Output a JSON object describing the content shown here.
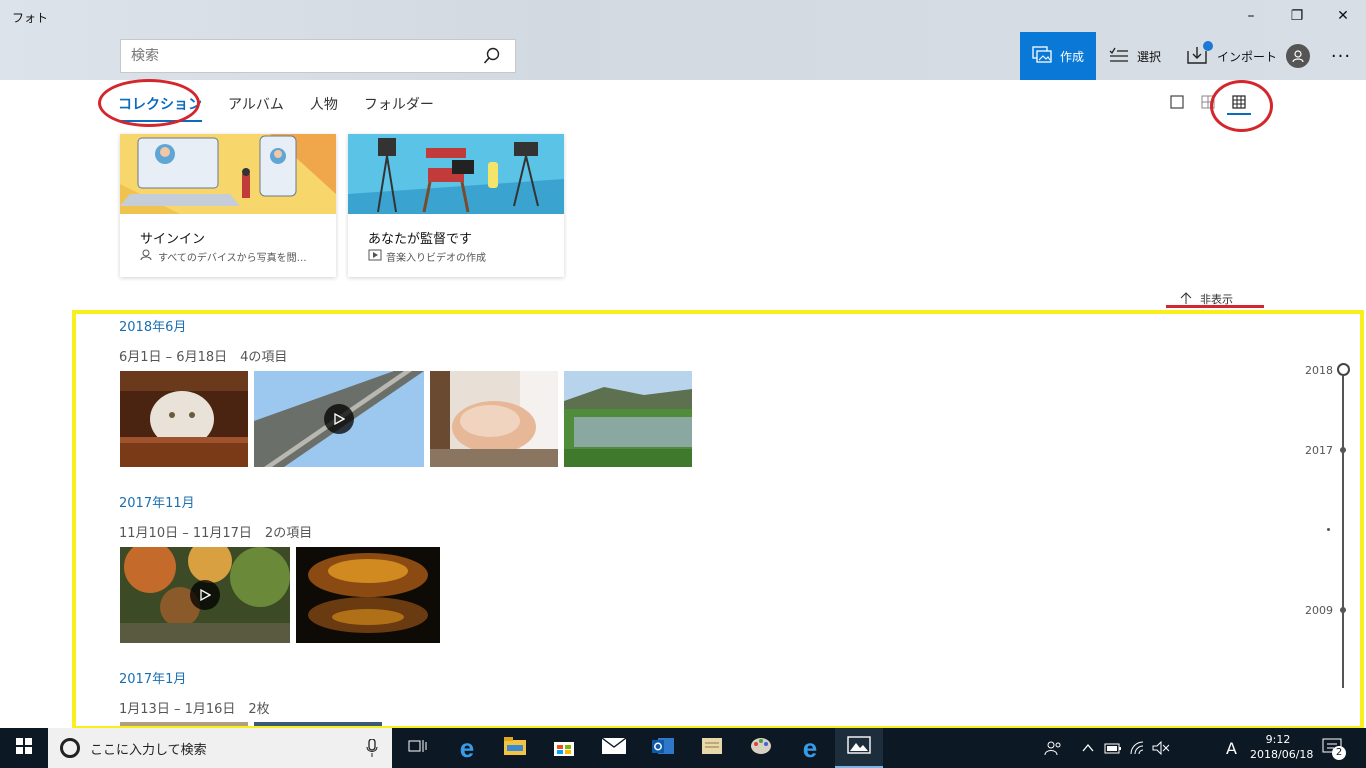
{
  "window": {
    "title": "フォト",
    "controls": {
      "minimize": "–",
      "maximize": "❐",
      "close": "✕"
    }
  },
  "search": {
    "placeholder": "検索"
  },
  "toolbar": {
    "create_label": "作成",
    "select_label": "選択",
    "import_label": "インポート",
    "more_label": "···"
  },
  "tabs": [
    {
      "label": "コレクション",
      "active": true
    },
    {
      "label": "アルバム"
    },
    {
      "label": "人物"
    },
    {
      "label": "フォルダー"
    }
  ],
  "cards": [
    {
      "title": "サインイン",
      "subtitle": "すべてのデバイスから写真を閲…",
      "icon": "person-sync-icon"
    },
    {
      "title": "あなたが監督です",
      "subtitle": "音楽入りビデオの作成",
      "icon": "video-icon"
    }
  ],
  "hide_label": "非表示",
  "groups": [
    {
      "month": "2018年6月",
      "range": "6月1日 – 6月18日　4の項目"
    },
    {
      "month": "2017年11月",
      "range": "11月10日 – 11月17日　2の項目"
    },
    {
      "month": "2017年1月",
      "range": "1月13日 – 1月16日　2枚"
    }
  ],
  "timeline": {
    "years": [
      "2018",
      "2017",
      "2009"
    ]
  },
  "taskbar": {
    "search_placeholder": "ここに入力して検索",
    "ime": "A",
    "time": "9:12",
    "date": "2018/06/18",
    "notifications": "2"
  },
  "colors": {
    "accent": "#0a78d7",
    "annotation_red": "#d4262c",
    "annotation_yellow": "#f8ef1d"
  }
}
